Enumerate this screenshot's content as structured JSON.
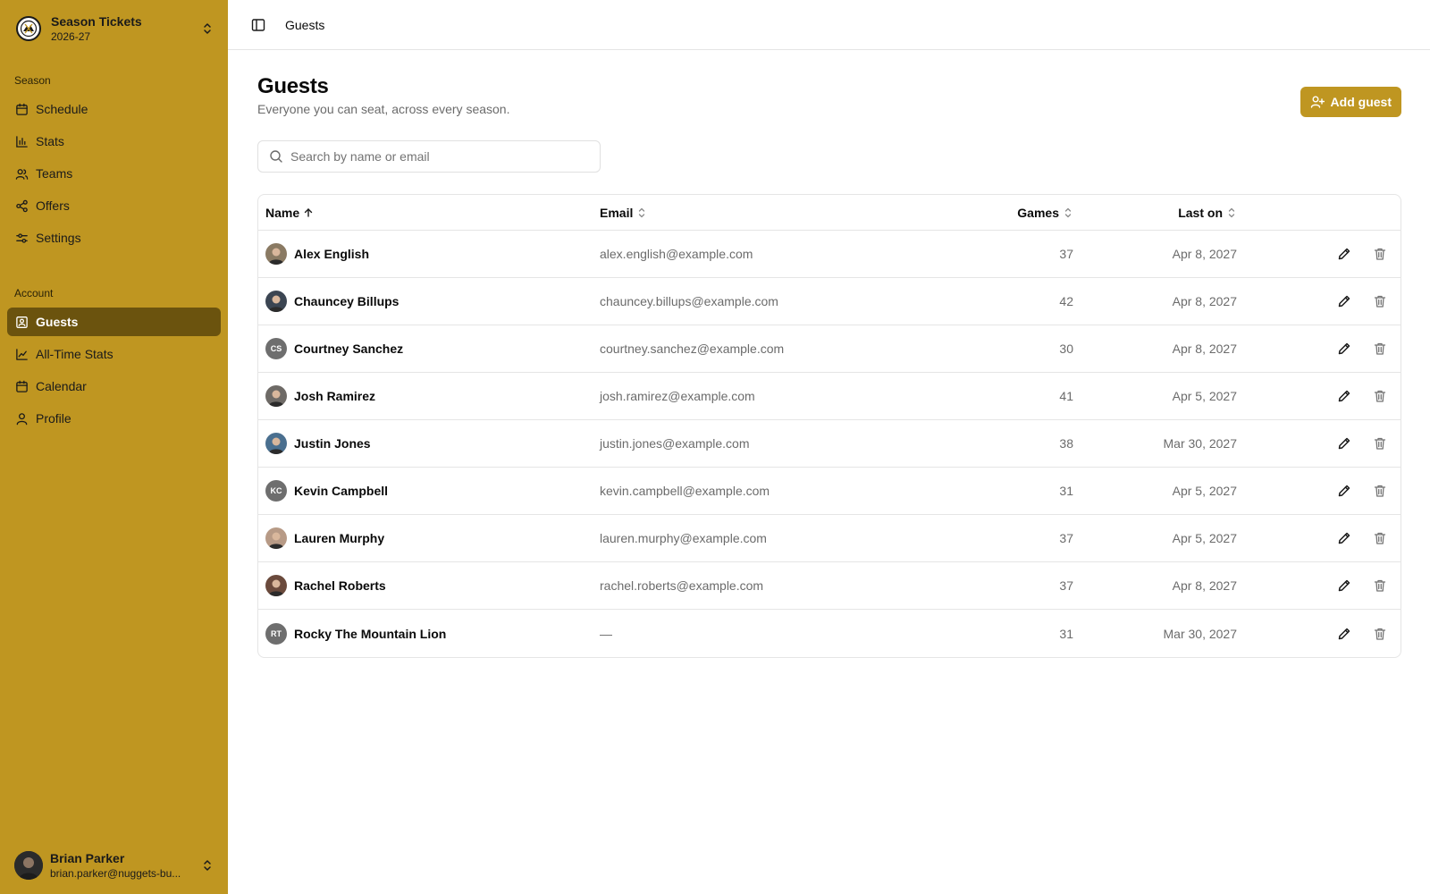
{
  "brand": {
    "title": "Season Tickets",
    "subtitle": "2026-27"
  },
  "sidebar": {
    "season_label": "Season",
    "season_items": [
      {
        "label": "Schedule",
        "icon": "calendar-icon"
      },
      {
        "label": "Stats",
        "icon": "bar-chart-icon"
      },
      {
        "label": "Teams",
        "icon": "users-icon"
      },
      {
        "label": "Offers",
        "icon": "share-icon"
      },
      {
        "label": "Settings",
        "icon": "sliders-icon"
      }
    ],
    "account_label": "Account",
    "account_items": [
      {
        "label": "Guests",
        "icon": "contact-icon",
        "active": true
      },
      {
        "label": "All-Time Stats",
        "icon": "line-chart-icon"
      },
      {
        "label": "Calendar",
        "icon": "calendar-icon"
      },
      {
        "label": "Profile",
        "icon": "user-icon"
      }
    ]
  },
  "user": {
    "name": "Brian Parker",
    "email": "brian.parker@nuggets-bu..."
  },
  "topbar": {
    "breadcrumb": "Guests"
  },
  "page": {
    "title": "Guests",
    "subtitle": "Everyone you can seat, across every season.",
    "add_button": "Add guest"
  },
  "search": {
    "placeholder": "Search by name or email",
    "value": ""
  },
  "table": {
    "columns": {
      "name": "Name",
      "email": "Email",
      "games": "Games",
      "last_on": "Last on"
    },
    "sort": {
      "column": "name",
      "direction": "asc"
    },
    "rows": [
      {
        "name": "Alex English",
        "email": "alex.english@example.com",
        "games": "37",
        "last_on": "Apr 8, 2027",
        "initials": "",
        "photo_bg": "#8a7a63"
      },
      {
        "name": "Chauncey Billups",
        "email": "chauncey.billups@example.com",
        "games": "42",
        "last_on": "Apr 8, 2027",
        "initials": "",
        "photo_bg": "#3b4552"
      },
      {
        "name": "Courtney Sanchez",
        "email": "courtney.sanchez@example.com",
        "games": "30",
        "last_on": "Apr 8, 2027",
        "initials": "CS",
        "photo_bg": ""
      },
      {
        "name": "Josh Ramirez",
        "email": "josh.ramirez@example.com",
        "games": "41",
        "last_on": "Apr 5, 2027",
        "initials": "",
        "photo_bg": "#6e6a66"
      },
      {
        "name": "Justin Jones",
        "email": "justin.jones@example.com",
        "games": "38",
        "last_on": "Mar 30, 2027",
        "initials": "",
        "photo_bg": "#4a6f8f"
      },
      {
        "name": "Kevin Campbell",
        "email": "kevin.campbell@example.com",
        "games": "31",
        "last_on": "Apr 5, 2027",
        "initials": "KC",
        "photo_bg": ""
      },
      {
        "name": "Lauren Murphy",
        "email": "lauren.murphy@example.com",
        "games": "37",
        "last_on": "Apr 5, 2027",
        "initials": "",
        "photo_bg": "#b79a86"
      },
      {
        "name": "Rachel Roberts",
        "email": "rachel.roberts@example.com",
        "games": "37",
        "last_on": "Apr 8, 2027",
        "initials": "",
        "photo_bg": "#6a4a3c"
      },
      {
        "name": "Rocky The Mountain Lion",
        "email": "—",
        "games": "31",
        "last_on": "Mar 30, 2027",
        "initials": "RT",
        "photo_bg": ""
      }
    ]
  },
  "colors": {
    "sidebar_bg": "#bf9621",
    "sidebar_active": "#6b530e",
    "accent": "#bf9621"
  }
}
